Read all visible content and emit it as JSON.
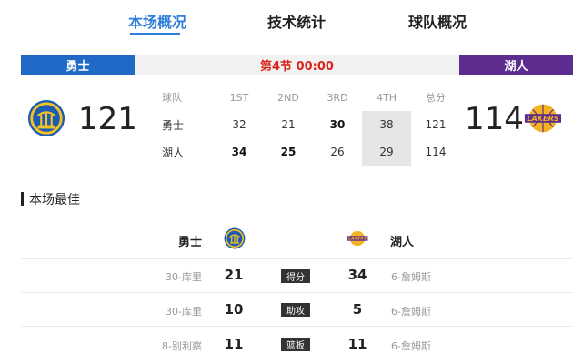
{
  "tabs": [
    {
      "label": "本场概况",
      "active": true
    },
    {
      "label": "技术统计",
      "active": false
    },
    {
      "label": "球队概况",
      "active": false
    }
  ],
  "status": {
    "home_team": "勇士",
    "away_team": "湖人",
    "period": "第4节 00:00"
  },
  "colors": {
    "accent": "#2f7fd8",
    "home": "#2169c6",
    "away": "#5c2c8e",
    "period": "#d9261c"
  },
  "score": {
    "home": "121",
    "away": "114",
    "home_logo": "warriors-logo-icon",
    "away_logo": "lakers-logo-icon"
  },
  "quarters": {
    "headers": [
      "球队",
      "1ST",
      "2ND",
      "3RD",
      "4TH",
      "总分"
    ],
    "rows": [
      {
        "team": "勇士",
        "q1": "32",
        "q2": "21",
        "q3": "30",
        "q4": "38",
        "total": "121"
      },
      {
        "team": "湖人",
        "q1": "34",
        "q2": "25",
        "q3": "26",
        "q4": "29",
        "total": "114"
      }
    ]
  },
  "best": {
    "title": "本场最佳",
    "home_team": "勇士",
    "away_team": "湖人",
    "rows": [
      {
        "home_player": "30-库里",
        "home_val": "21",
        "category": "得分",
        "away_val": "34",
        "away_player": "6-詹姆斯"
      },
      {
        "home_player": "30-库里",
        "home_val": "10",
        "category": "助攻",
        "away_val": "5",
        "away_player": "6-詹姆斯"
      },
      {
        "home_player": "8-别利察",
        "home_val": "11",
        "category": "篮板",
        "away_val": "11",
        "away_player": "6-詹姆斯"
      }
    ]
  }
}
